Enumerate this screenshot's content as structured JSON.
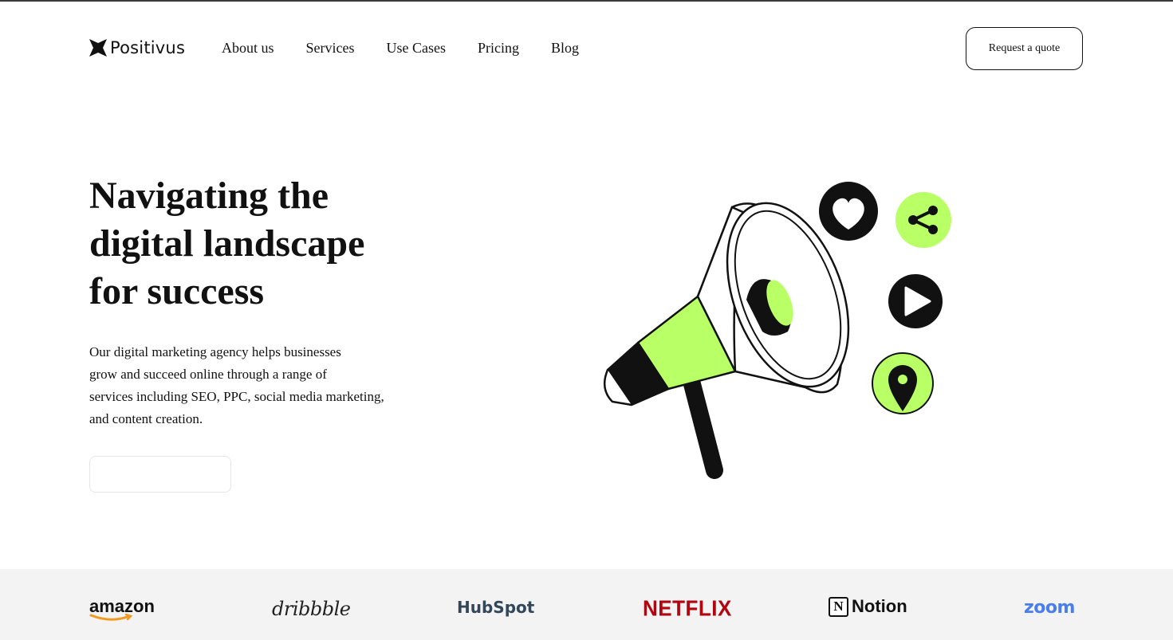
{
  "brand": {
    "name": "Positivus",
    "icon": "positivus-star-icon"
  },
  "nav": {
    "links": [
      "About us",
      "Services",
      "Use Cases",
      "Pricing",
      "Blog"
    ],
    "cta_label": "Request a quote"
  },
  "hero": {
    "title_lines": [
      "Navigating the",
      "digital landscape",
      "for success"
    ],
    "description_lines": [
      "Our digital marketing agency helps businesses",
      "grow and succeed online through a range of",
      "services including SEO, PPC, social media marketing,",
      "and content creation."
    ],
    "cta_label": "",
    "illustration_icons": [
      "megaphone-icon",
      "heart-icon",
      "share-icon",
      "play-icon",
      "location-pin-icon"
    ]
  },
  "logos": {
    "items": [
      "amazon",
      "dribbble",
      "HubSpot",
      "NETFLIX",
      "Notion",
      "zoom"
    ]
  },
  "colors": {
    "accent": "#B9FF66",
    "dark": "#191A23",
    "logo_strip_bg": "#F3F3F3",
    "netflix": "#B1060F",
    "hubspot": "#33475B",
    "zoom": "#4A7DEE"
  }
}
